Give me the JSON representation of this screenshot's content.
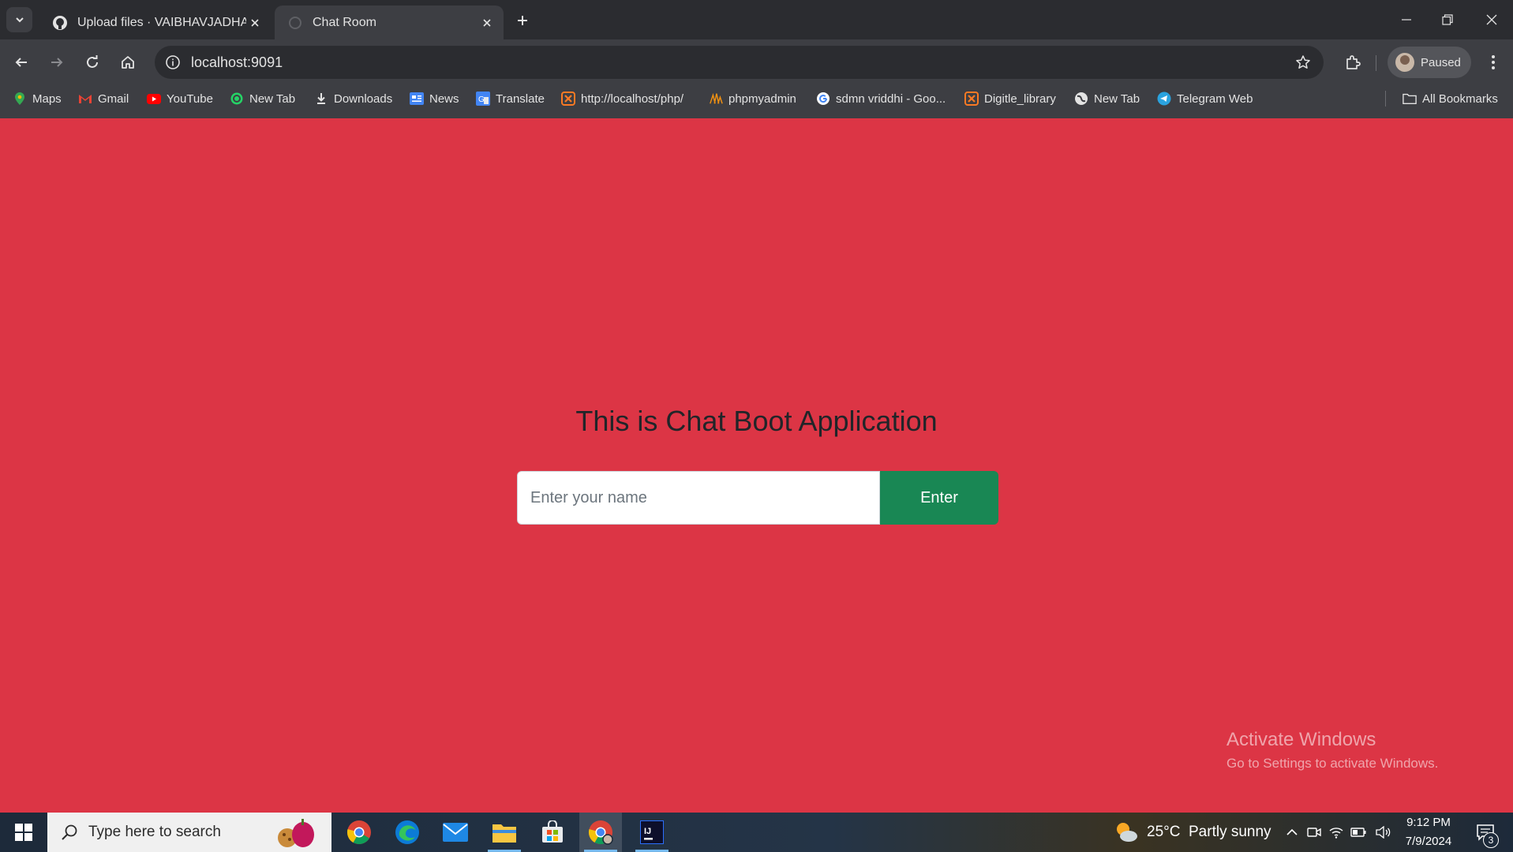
{
  "browser": {
    "tabs": [
      {
        "title": "Upload files · VAIBHAVJADHAV1",
        "icon": "github-icon"
      },
      {
        "title": "Chat Room",
        "icon": "loading-globe-icon"
      }
    ],
    "address_bar": {
      "url": "localhost:9091"
    },
    "profile": {
      "label": "Paused"
    },
    "bookmarks": [
      {
        "label": "Maps",
        "icon": "maps-icon"
      },
      {
        "label": "Gmail",
        "icon": "gmail-icon"
      },
      {
        "label": "YouTube",
        "icon": "youtube-icon"
      },
      {
        "label": "New Tab",
        "icon": "whatsapp-icon"
      },
      {
        "label": "Downloads",
        "icon": "download-icon"
      },
      {
        "label": "News",
        "icon": "news-icon"
      },
      {
        "label": "Translate",
        "icon": "translate-icon"
      },
      {
        "label": "http://localhost/php/",
        "icon": "xampp-icon"
      },
      {
        "label": "phpmyadmin",
        "icon": "phpmyadmin-icon"
      },
      {
        "label": "sdmn vriddhi - Goo...",
        "icon": "google-icon"
      },
      {
        "label": "Digitle_library",
        "icon": "xampp-icon"
      },
      {
        "label": "New Tab",
        "icon": "globe-icon"
      },
      {
        "label": "Telegram Web",
        "icon": "telegram-icon"
      }
    ],
    "all_bookmarks_label": "All Bookmarks"
  },
  "page": {
    "heading": "This is Chat Boot Application",
    "name_input": {
      "placeholder": "Enter your name",
      "value": ""
    },
    "enter_button": "Enter",
    "background_color": "#dc3545",
    "button_color": "#198754"
  },
  "watermark": {
    "line1": "Activate Windows",
    "line2": "Go to Settings to activate Windows."
  },
  "taskbar": {
    "search_placeholder": "Type here to search",
    "apps": [
      "chrome-icon",
      "edge-icon",
      "mail-icon",
      "file-explorer-icon",
      "store-icon",
      "chrome-profile-icon",
      "intellij-icon"
    ],
    "weather": {
      "text": "25°C  Partly sunny"
    },
    "time": "9:12 PM",
    "date": "7/9/2024",
    "notification_count": "3"
  }
}
